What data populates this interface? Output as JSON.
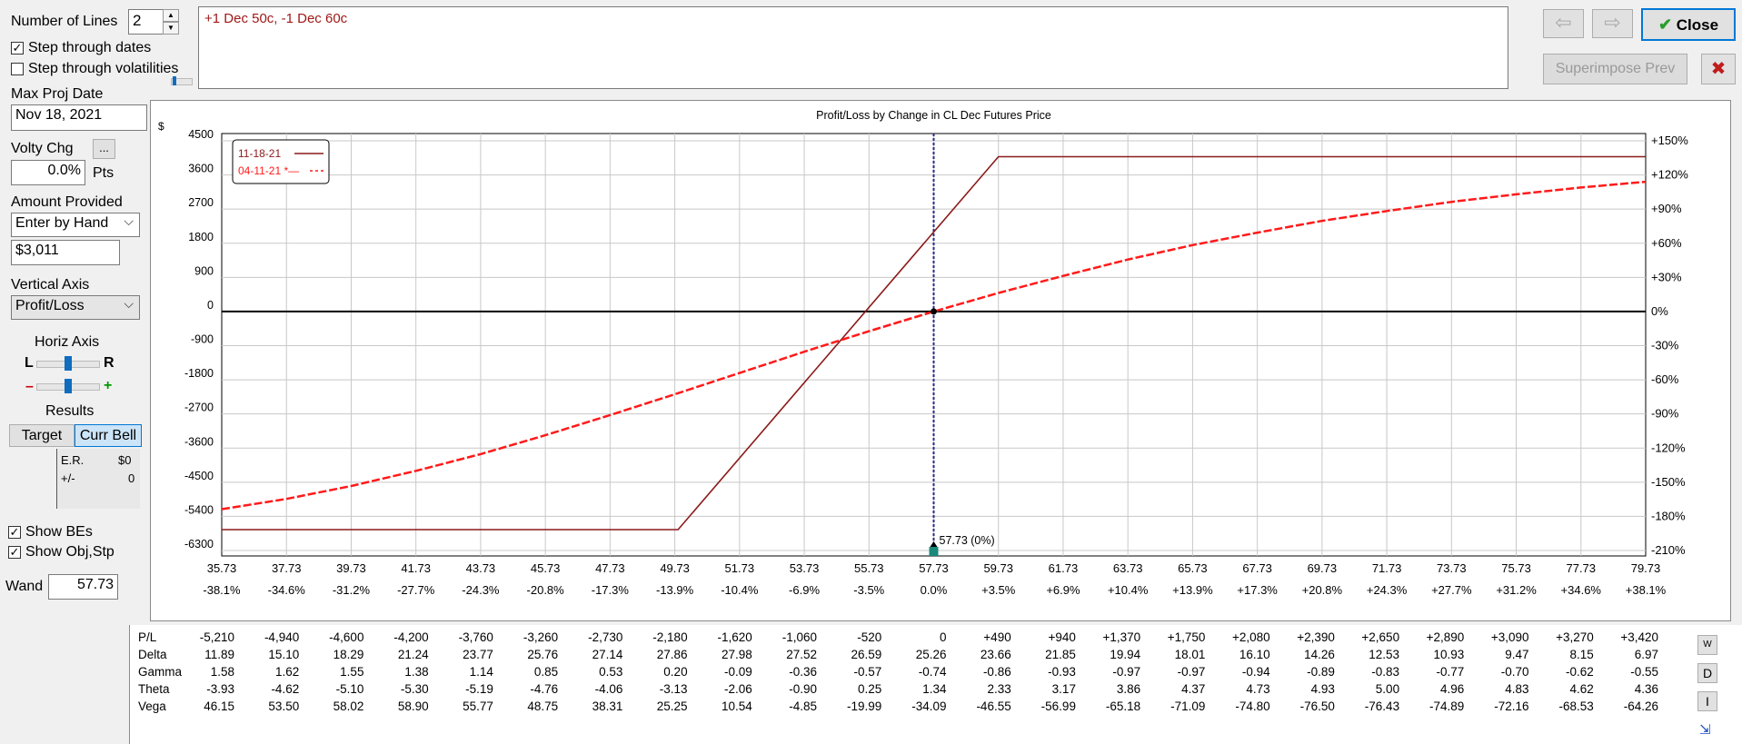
{
  "left_panel": {
    "number_of_lines_label": "Number of Lines",
    "number_of_lines_value": "2",
    "step_dates_label": "Step through dates",
    "step_dates_checked": true,
    "step_vols_label": "Step through volatilities",
    "step_vols_checked": false,
    "max_proj_date_label": "Max Proj Date",
    "max_proj_date_value": "Nov 18, 2021",
    "volty_chg_label": "Volty Chg",
    "volty_button": "...",
    "volty_value": "0.0%",
    "volty_unit": "Pts",
    "amount_provided_label": "Amount Provided",
    "amount_provided_select": "Enter by Hand",
    "amount_value": "$3,011",
    "vertical_axis_label": "Vertical Axis",
    "vertical_axis_select": "Profit/Loss",
    "horiz_axis_label": "Horiz Axis",
    "slider_l": "L",
    "slider_r": "R",
    "slider_minus": "–",
    "slider_plus": "+",
    "results_label": "Results",
    "target_button": "Target",
    "curr_bell_button": "Curr Bell",
    "er_label": "E.R.",
    "er_value": "$0",
    "pm_label": "+/-",
    "pm_value": "0",
    "show_bes_label": "Show BEs",
    "show_bes_checked": true,
    "show_obj_label": "Show Obj,Stp",
    "show_obj_checked": true,
    "wand_label": "Wand",
    "wand_value": "57.73"
  },
  "top": {
    "position_text": "+1 Dec 50c, -1 Dec 60c",
    "close_label": "Close",
    "superimpose_label": "Superimpose Prev",
    "back_arrow": "⇦",
    "fwd_arrow": "⇨",
    "check_icon": "✔",
    "x_icon": "✖"
  },
  "chart_data": {
    "type": "line",
    "title": "Profit/Loss by Change in CL Dec Futures Price",
    "y_unit": "$",
    "x_ticks": [
      "35.73",
      "37.73",
      "39.73",
      "41.73",
      "43.73",
      "45.73",
      "47.73",
      "49.73",
      "51.73",
      "53.73",
      "55.73",
      "57.73",
      "59.73",
      "61.73",
      "63.73",
      "65.73",
      "67.73",
      "69.73",
      "71.73",
      "73.73",
      "75.73",
      "77.73",
      "79.73"
    ],
    "x_pct_ticks": [
      "-38.1%",
      "-34.6%",
      "-31.2%",
      "-27.7%",
      "-24.3%",
      "-20.8%",
      "-17.3%",
      "-13.9%",
      "-10.4%",
      "-6.9%",
      "-3.5%",
      "0.0%",
      "+3.5%",
      "+6.9%",
      "+10.4%",
      "+13.9%",
      "+17.3%",
      "+20.8%",
      "+24.3%",
      "+27.7%",
      "+31.2%",
      "+34.6%",
      "+38.1%"
    ],
    "y_ticks": [
      "4500",
      "3600",
      "2700",
      "1800",
      "900",
      "0",
      "-900",
      "-1800",
      "-2700",
      "-3600",
      "-4500",
      "-5400",
      "-6300"
    ],
    "y_pct_ticks": [
      "+150%",
      "+120%",
      "+90%",
      "+60%",
      "+30%",
      "0%",
      "-30%",
      "-60%",
      "-90%",
      "-120%",
      "-150%",
      "-180%",
      "-210%"
    ],
    "ylim": [
      -6300,
      4500
    ],
    "xlim": [
      35.73,
      79.73
    ],
    "current_price": 57.73,
    "current_label": "57.73 (0%)",
    "legend_placement": "top-left",
    "grid": true,
    "series": [
      {
        "name": "11-18-21",
        "color": "#8b1a1a",
        "style": "solid",
        "points": [
          [
            35.73,
            -5750
          ],
          [
            49.83,
            -5750
          ],
          [
            59.73,
            4080
          ],
          [
            79.73,
            4080
          ]
        ]
      },
      {
        "name": "04-11-21",
        "legend_suffix": "*—",
        "color": "#ff1a1a",
        "style": "dashed",
        "points": [
          [
            35.73,
            -5210
          ],
          [
            37.73,
            -4940
          ],
          [
            39.73,
            -4600
          ],
          [
            41.73,
            -4200
          ],
          [
            43.73,
            -3760
          ],
          [
            45.73,
            -3260
          ],
          [
            47.73,
            -2730
          ],
          [
            49.73,
            -2180
          ],
          [
            51.73,
            -1620
          ],
          [
            53.73,
            -1060
          ],
          [
            55.73,
            -520
          ],
          [
            57.73,
            0
          ],
          [
            59.73,
            490
          ],
          [
            61.73,
            940
          ],
          [
            63.73,
            1370
          ],
          [
            65.73,
            1750
          ],
          [
            67.73,
            2080
          ],
          [
            69.73,
            2390
          ],
          [
            71.73,
            2650
          ],
          [
            73.73,
            2890
          ],
          [
            75.73,
            3090
          ],
          [
            77.73,
            3270
          ],
          [
            79.73,
            3420
          ]
        ]
      }
    ]
  },
  "greeks": {
    "rows": [
      {
        "label": "P/L",
        "values": [
          "-5,210",
          "-4,940",
          "-4,600",
          "-4,200",
          "-3,760",
          "-3,260",
          "-2,730",
          "-2,180",
          "-1,620",
          "-1,060",
          "-520",
          "0",
          "+490",
          "+940",
          "+1,370",
          "+1,750",
          "+2,080",
          "+2,390",
          "+2,650",
          "+2,890",
          "+3,090",
          "+3,270",
          "+3,420"
        ]
      },
      {
        "label": "Delta",
        "values": [
          "11.89",
          "15.10",
          "18.29",
          "21.24",
          "23.77",
          "25.76",
          "27.14",
          "27.86",
          "27.98",
          "27.52",
          "26.59",
          "25.26",
          "23.66",
          "21.85",
          "19.94",
          "18.01",
          "16.10",
          "14.26",
          "12.53",
          "10.93",
          "9.47",
          "8.15",
          "6.97"
        ]
      },
      {
        "label": "Gamma",
        "values": [
          "1.58",
          "1.62",
          "1.55",
          "1.38",
          "1.14",
          "0.85",
          "0.53",
          "0.20",
          "-0.09",
          "-0.36",
          "-0.57",
          "-0.74",
          "-0.86",
          "-0.93",
          "-0.97",
          "-0.97",
          "-0.94",
          "-0.89",
          "-0.83",
          "-0.77",
          "-0.70",
          "-0.62",
          "-0.55"
        ]
      },
      {
        "label": "Theta",
        "values": [
          "-3.93",
          "-4.62",
          "-5.10",
          "-5.30",
          "-5.19",
          "-4.76",
          "-4.06",
          "-3.13",
          "-2.06",
          "-0.90",
          "0.25",
          "1.34",
          "2.33",
          "3.17",
          "3.86",
          "4.37",
          "4.73",
          "4.93",
          "5.00",
          "4.96",
          "4.83",
          "4.62",
          "4.36"
        ]
      },
      {
        "label": "Vega",
        "values": [
          "46.15",
          "53.50",
          "58.02",
          "58.90",
          "55.77",
          "48.75",
          "38.31",
          "25.25",
          "10.54",
          "-4.85",
          "-19.99",
          "-34.09",
          "-46.55",
          "-56.99",
          "-65.18",
          "-71.09",
          "-74.80",
          "-76.50",
          "-76.43",
          "-74.89",
          "-72.16",
          "-68.53",
          "-64.26"
        ]
      }
    ],
    "side_buttons": [
      "W",
      "D",
      "I"
    ]
  }
}
